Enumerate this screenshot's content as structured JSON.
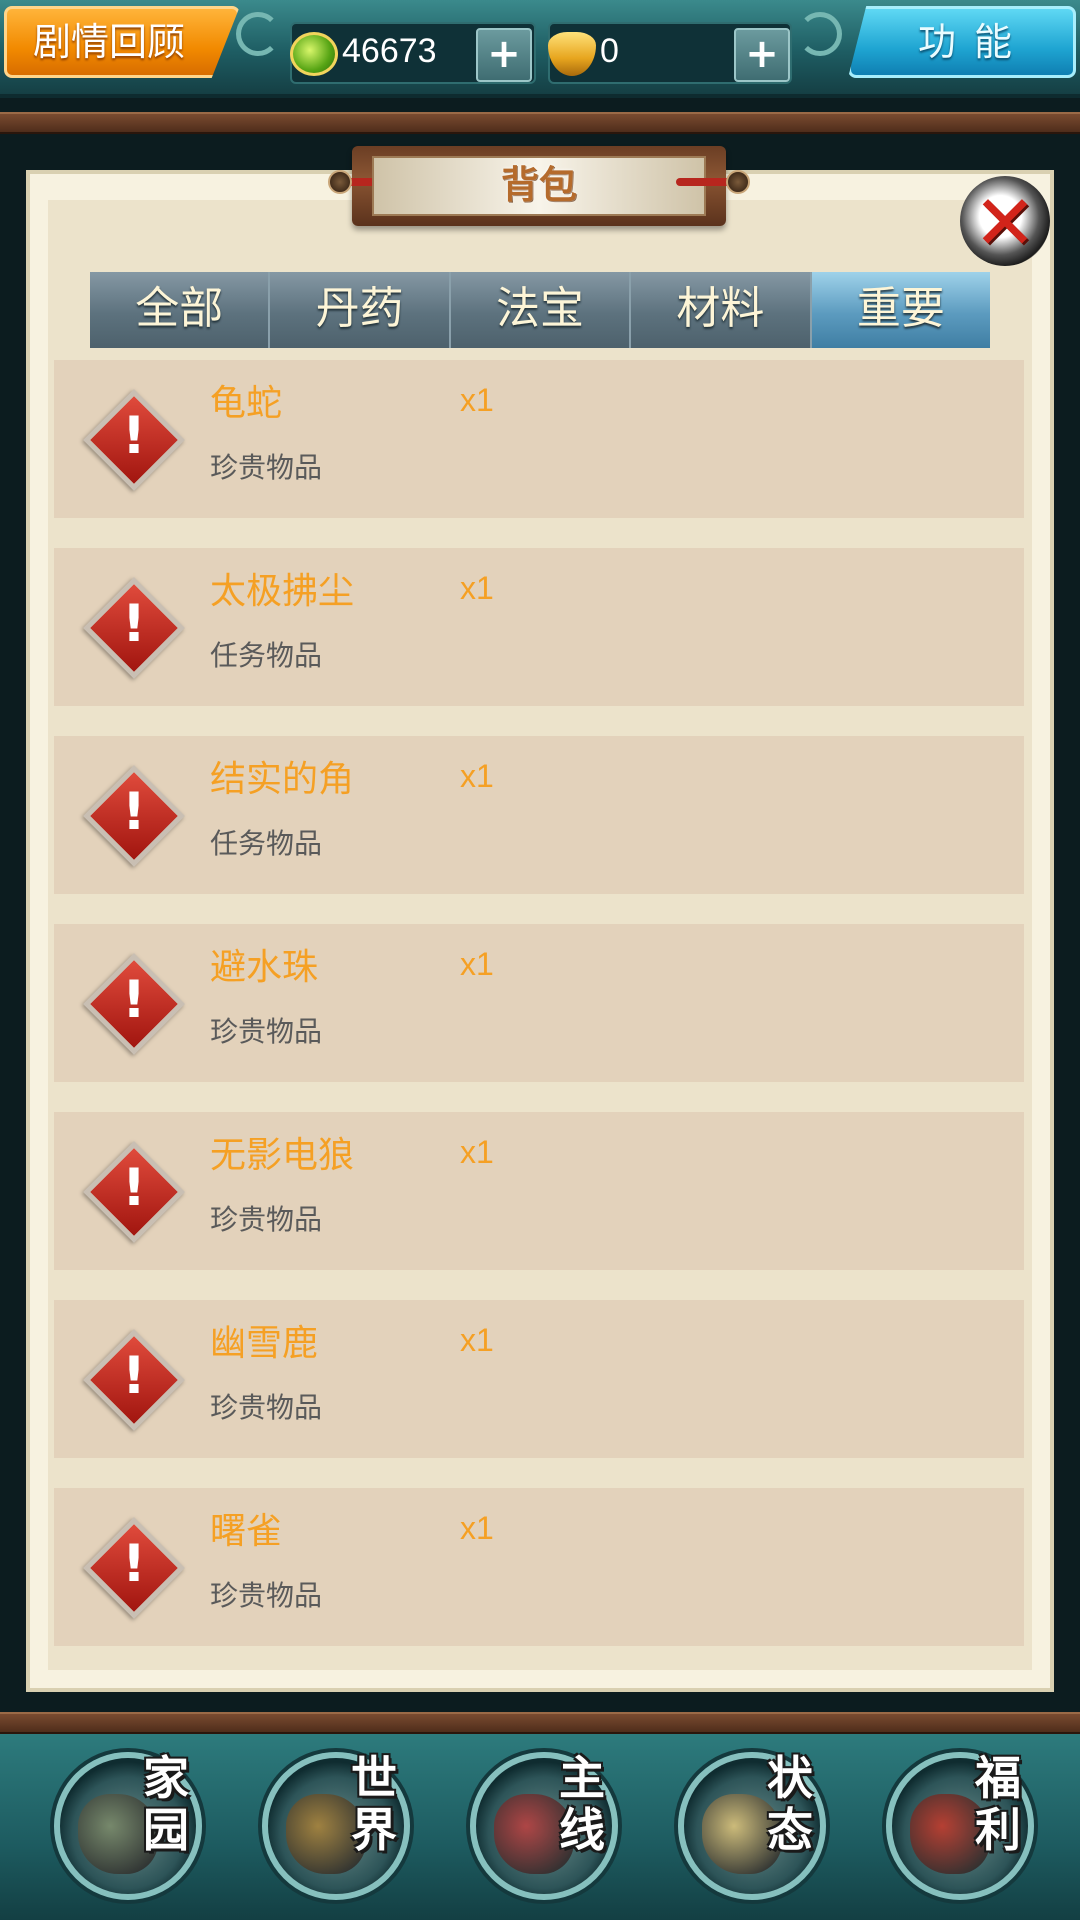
{
  "topbar": {
    "story_label": "剧情回顾",
    "function_label": "功能",
    "coins": "46673",
    "gold": "0",
    "plus": "+"
  },
  "panel": {
    "title": "背包",
    "close_glyph": "✕"
  },
  "tabs": [
    {
      "label": "全部",
      "active": false
    },
    {
      "label": "丹药",
      "active": false
    },
    {
      "label": "法宝",
      "active": false
    },
    {
      "label": "材料",
      "active": false
    },
    {
      "label": "重要",
      "active": true
    }
  ],
  "items": [
    {
      "name": "龟蛇",
      "qty": "x1",
      "type": "珍贵物品",
      "icon": "warning-icon"
    },
    {
      "name": "太极拂尘",
      "qty": "x1",
      "type": "任务物品",
      "icon": "warning-icon"
    },
    {
      "name": "结实的角",
      "qty": "x1",
      "type": "任务物品",
      "icon": "warning-icon"
    },
    {
      "name": "避水珠",
      "qty": "x1",
      "type": "珍贵物品",
      "icon": "warning-icon"
    },
    {
      "name": "无影电狼",
      "qty": "x1",
      "type": "珍贵物品",
      "icon": "warning-icon"
    },
    {
      "name": "幽雪鹿",
      "qty": "x1",
      "type": "珍贵物品",
      "icon": "warning-icon"
    },
    {
      "name": "曙雀",
      "qty": "x1",
      "type": "珍贵物品",
      "icon": "warning-icon"
    }
  ],
  "bottom_nav": [
    {
      "label_top": "家",
      "label_bottom": "园",
      "icon": "home-icon",
      "color": "#7a8a6a"
    },
    {
      "label_top": "世",
      "label_bottom": "界",
      "icon": "world-map-icon",
      "color": "#a7823a"
    },
    {
      "label_top": "主",
      "label_bottom": "线",
      "icon": "main-quest-icon",
      "color": "#b84040"
    },
    {
      "label_top": "状",
      "label_bottom": "态",
      "icon": "status-bagua-icon",
      "color": "#d9c27a"
    },
    {
      "label_top": "福",
      "label_bottom": "利",
      "icon": "welfare-bag-icon",
      "color": "#c0392b"
    }
  ],
  "colors": {
    "item_name": "#f5a024",
    "item_bg": "#e3d2bb",
    "tab_active": "#5c9bbf",
    "story_button": "#f28a00",
    "function_button": "#1fa5d2"
  }
}
